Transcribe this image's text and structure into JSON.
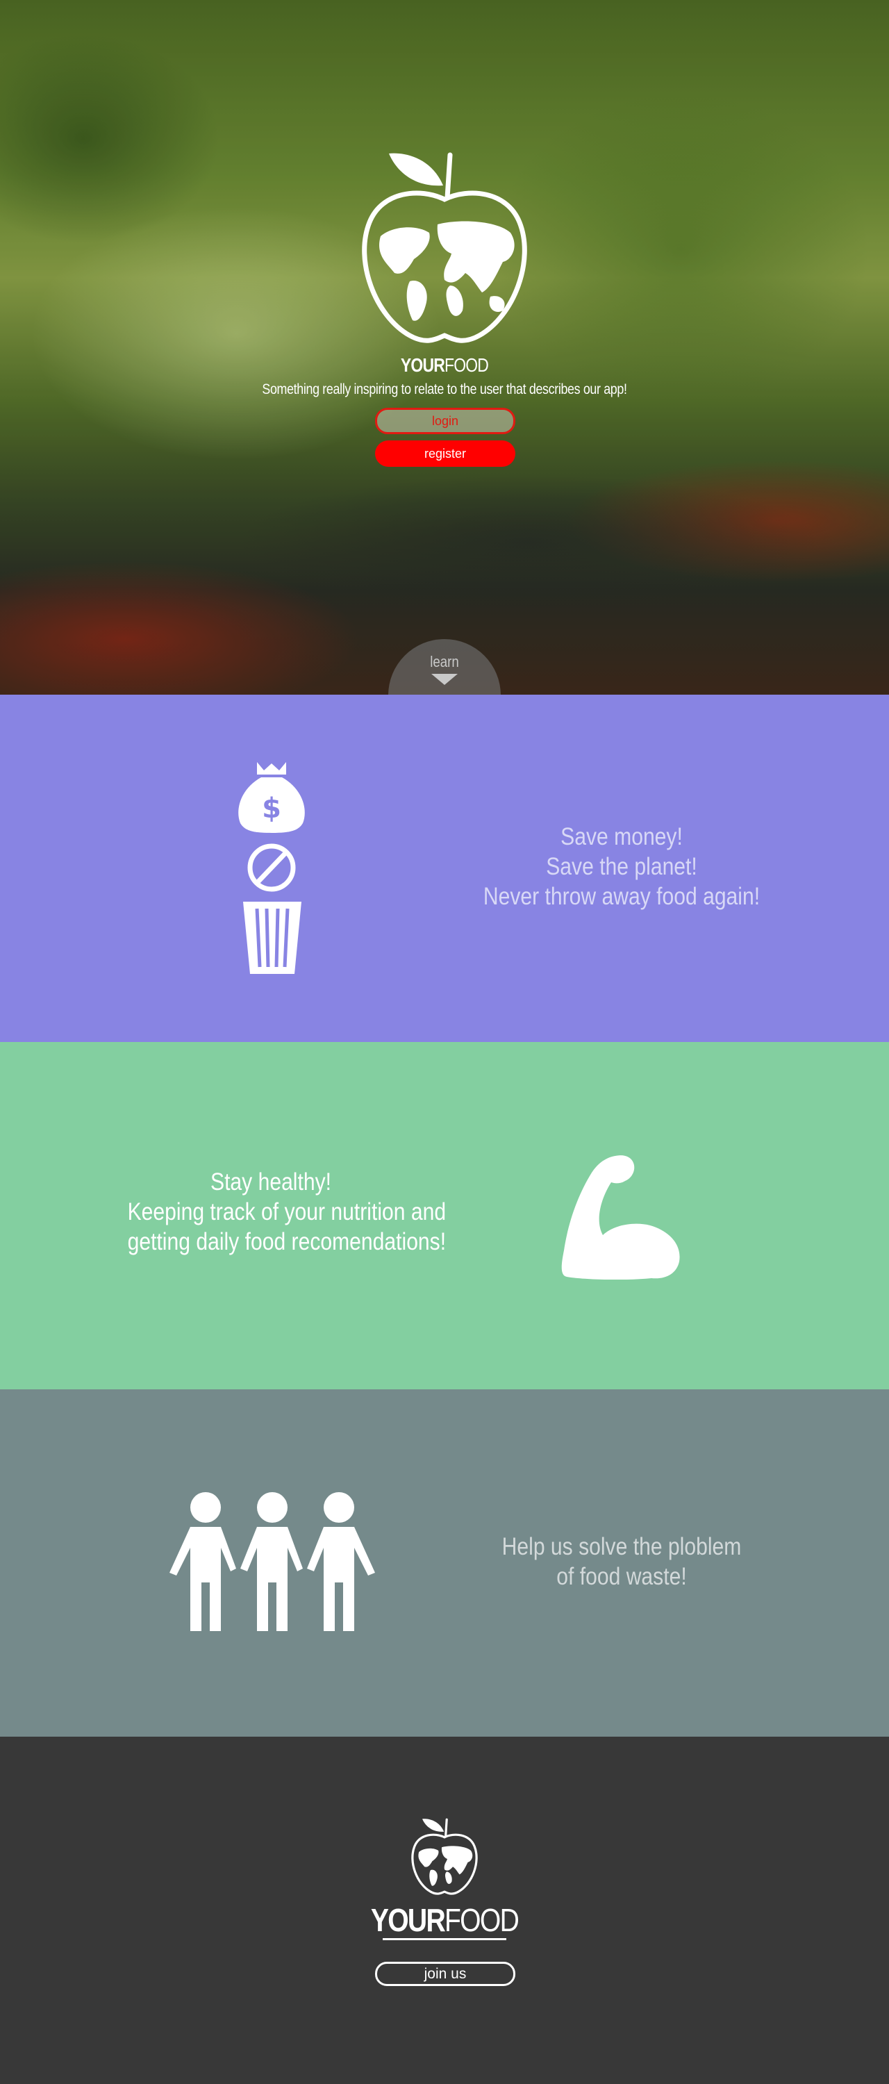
{
  "hero": {
    "brand_bold": "YOUR",
    "brand_light": "FOOD",
    "tagline": "Something really inspiring to relate to the user that describes our app!",
    "login_label": "login",
    "register_label": "register",
    "learn_label": "learn"
  },
  "features": [
    {
      "lines": [
        "Save money!",
        "Save the planet!",
        "Never throw away food again!"
      ],
      "color": "#8884e3"
    },
    {
      "lines": [
        "Stay healthy!",
        "Keeping track of your nutrition and",
        "getting daily food recomendations!"
      ],
      "color": "#83cfa0"
    },
    {
      "lines": [
        "Help us solve the ploblem",
        "of food waste!"
      ],
      "color": "#758a8b"
    }
  ],
  "footer": {
    "brand_bold": "YOUR",
    "brand_light": "FOOD",
    "join_label": "join us",
    "color": "#383838"
  },
  "icons": [
    "apple-globe-icon",
    "money-bag-icon",
    "prohibited-icon",
    "trash-bin-icon",
    "flexed-arm-icon",
    "people-holding-hands-icon"
  ],
  "colors": {
    "accent_red": "#ff0000"
  }
}
